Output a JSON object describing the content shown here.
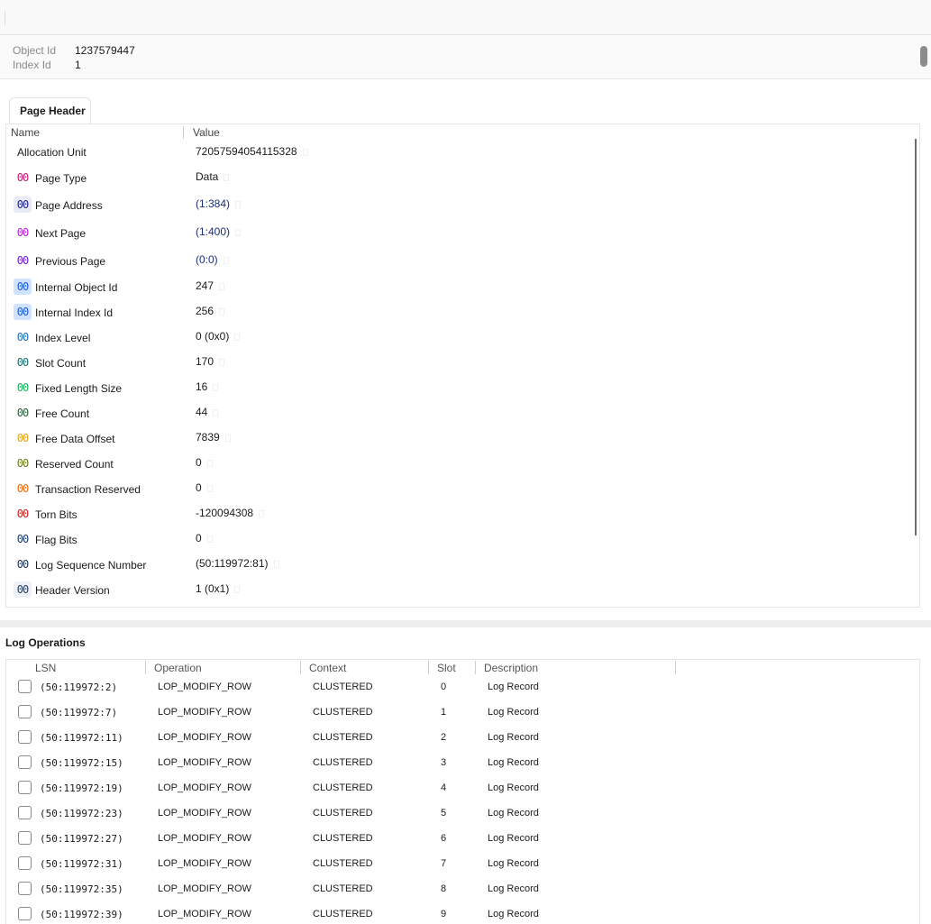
{
  "object_info": {
    "object_id_label": "Object Id",
    "object_id": "1237579447",
    "index_id_label": "Index Id",
    "index_id": "1"
  },
  "tabs": [
    {
      "label": "Page Header"
    }
  ],
  "page_header": {
    "col_name": "Name",
    "col_value": "Value",
    "allocation_unit_label": "Allocation Unit",
    "allocation_unit_value": "72057594054115328",
    "badge_glyph": "00",
    "rows": [
      {
        "name": "Page Type",
        "value": "Data",
        "badge_color": "#c0196b",
        "badge_bg": "#ffffff",
        "link": false
      },
      {
        "name": "Page Address",
        "value": "(1:384)",
        "badge_color": "#1b1f8a",
        "badge_bg": "#e8eaf6",
        "link": true
      },
      {
        "name": "Next Page",
        "value": "(1:400)",
        "badge_color": "#b61fd8",
        "badge_bg": "#ffffff",
        "link": true
      },
      {
        "name": "Previous Page",
        "value": "(0:0)",
        "badge_color": "#6a1fc9",
        "badge_bg": "#ffffff",
        "link": true
      },
      {
        "name": "Internal Object Id",
        "value": "247",
        "badge_color": "#1e5bd6",
        "badge_bg": "#cfe2ff",
        "link": false
      },
      {
        "name": "Internal Index Id",
        "value": "256",
        "badge_color": "#1e5bd6",
        "badge_bg": "#cfe2ff",
        "link": false
      },
      {
        "name": "Index Level",
        "value": "0 (0x0)",
        "badge_color": "#1f6fbf",
        "badge_bg": "#ffffff",
        "link": false
      },
      {
        "name": "Slot Count",
        "value": "170",
        "badge_color": "#1a6b6b",
        "badge_bg": "#ffffff",
        "link": false
      },
      {
        "name": "Fixed Length Size",
        "value": "16",
        "badge_color": "#1bb35a",
        "badge_bg": "#ffffff",
        "link": false
      },
      {
        "name": "Free Count",
        "value": "44",
        "badge_color": "#2a5a3a",
        "badge_bg": "#ffffff",
        "link": false
      },
      {
        "name": "Free Data Offset",
        "value": "7839",
        "badge_color": "#e6a11c",
        "badge_bg": "#ffffff",
        "link": false
      },
      {
        "name": "Reserved Count",
        "value": "0",
        "badge_color": "#6b7a1a",
        "badge_bg": "#ffffff",
        "link": false
      },
      {
        "name": "Transaction Reserved",
        "value": "0",
        "badge_color": "#e46a12",
        "badge_bg": "#ffffff",
        "link": false
      },
      {
        "name": "Torn Bits",
        "value": "-120094308",
        "badge_color": "#c9201f",
        "badge_bg": "#ffffff",
        "link": false
      },
      {
        "name": "Flag Bits",
        "value": "0",
        "badge_color": "#1a3a6b",
        "badge_bg": "#ffffff",
        "link": false
      },
      {
        "name": "Log Sequence Number",
        "value": "(50:119972:81)",
        "badge_color": "#1a3050",
        "badge_bg": "#ffffff",
        "link": false
      },
      {
        "name": "Header Version",
        "value": "1 (0x1)",
        "badge_color": "#2a3a5a",
        "badge_bg": "#eef2f8",
        "link": false
      }
    ]
  },
  "log_operations": {
    "title": "Log Operations",
    "columns": [
      "LSN",
      "Operation",
      "Context",
      "Slot",
      "Description"
    ],
    "rows": [
      {
        "lsn": "(50:119972:2)",
        "operation": "LOP_MODIFY_ROW",
        "context": "CLUSTERED",
        "slot": "0",
        "description": "Log Record"
      },
      {
        "lsn": "(50:119972:7)",
        "operation": "LOP_MODIFY_ROW",
        "context": "CLUSTERED",
        "slot": "1",
        "description": "Log Record"
      },
      {
        "lsn": "(50:119972:11)",
        "operation": "LOP_MODIFY_ROW",
        "context": "CLUSTERED",
        "slot": "2",
        "description": "Log Record"
      },
      {
        "lsn": "(50:119972:15)",
        "operation": "LOP_MODIFY_ROW",
        "context": "CLUSTERED",
        "slot": "3",
        "description": "Log Record"
      },
      {
        "lsn": "(50:119972:19)",
        "operation": "LOP_MODIFY_ROW",
        "context": "CLUSTERED",
        "slot": "4",
        "description": "Log Record"
      },
      {
        "lsn": "(50:119972:23)",
        "operation": "LOP_MODIFY_ROW",
        "context": "CLUSTERED",
        "slot": "5",
        "description": "Log Record"
      },
      {
        "lsn": "(50:119972:27)",
        "operation": "LOP_MODIFY_ROW",
        "context": "CLUSTERED",
        "slot": "6",
        "description": "Log Record"
      },
      {
        "lsn": "(50:119972:31)",
        "operation": "LOP_MODIFY_ROW",
        "context": "CLUSTERED",
        "slot": "7",
        "description": "Log Record"
      },
      {
        "lsn": "(50:119972:35)",
        "operation": "LOP_MODIFY_ROW",
        "context": "CLUSTERED",
        "slot": "8",
        "description": "Log Record"
      },
      {
        "lsn": "(50:119972:39)",
        "operation": "LOP_MODIFY_ROW",
        "context": "CLUSTERED",
        "slot": "9",
        "description": "Log Record"
      }
    ]
  }
}
